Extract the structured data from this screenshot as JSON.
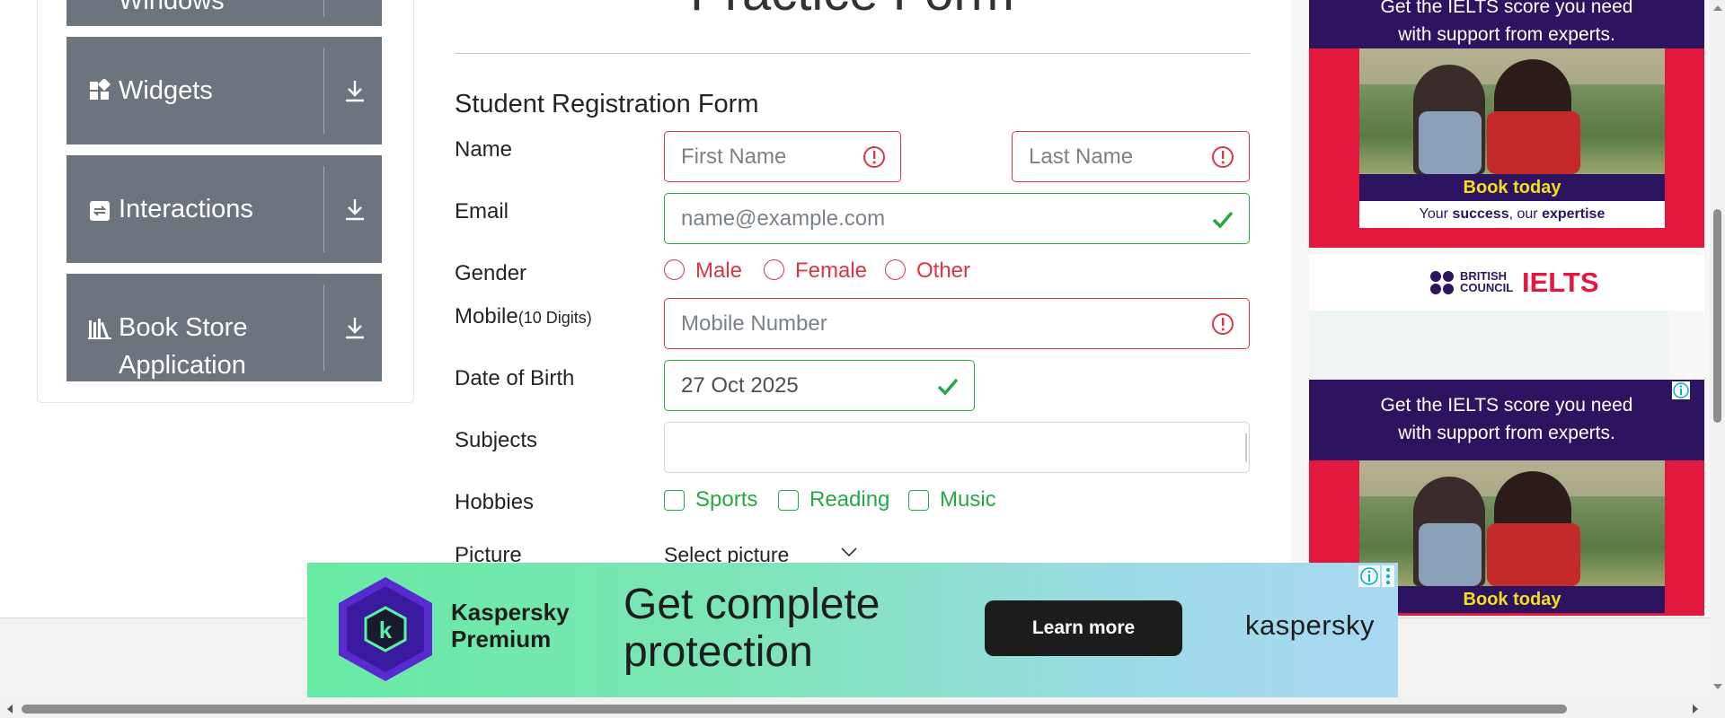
{
  "sidebar": {
    "items": [
      {
        "label": "Windows",
        "icon": "alert-icon"
      },
      {
        "label": "Widgets",
        "icon": "widgets-icon"
      },
      {
        "label": "Interactions",
        "icon": "interactions-icon"
      },
      {
        "label_line1": "Book Store",
        "label_line2": "Application",
        "icon": "book-store-icon"
      }
    ]
  },
  "form": {
    "page_title": "Practice Form",
    "heading": "Student Registration Form",
    "name_label": "Name",
    "first_name_placeholder": "First Name",
    "last_name_placeholder": "Last Name",
    "email_label": "Email",
    "email_placeholder": "name@example.com",
    "gender_label": "Gender",
    "gender_options": [
      "Male",
      "Female",
      "Other"
    ],
    "mobile_label": "Mobile",
    "mobile_hint": "(10 Digits)",
    "mobile_placeholder": "Mobile Number",
    "dob_label": "Date of Birth",
    "dob_value": "27 Oct 2025",
    "subjects_label": "Subjects",
    "subjects_value": "",
    "hobbies_label": "Hobbies",
    "hobbies_options": [
      "Sports",
      "Reading",
      "Music"
    ],
    "picture_label": "Picture",
    "picture_select": "Select picture"
  },
  "ads": {
    "ielts_headline_line1": "Get the IELTS score you need",
    "ielts_headline_line2": "with support from experts.",
    "ielts_cta": "Book today",
    "ielts_tagline_prefix": "Your ",
    "ielts_tagline_b1": "success",
    "ielts_tagline_mid": ", our ",
    "ielts_tagline_b2": "expertise",
    "ielts_brand1_line1": "BRITISH",
    "ielts_brand1_line2": "COUNCIL",
    "ielts_brand2": "IELTS",
    "kaspersky_product_line1": "Kaspersky",
    "kaspersky_product_line2": "Premium",
    "kaspersky_headline_line1": "Get complete",
    "kaspersky_headline_line2": "protection",
    "kaspersky_cta": "Learn more",
    "kaspersky_brand": "kaspersky"
  },
  "colors": {
    "sidebar_item": "#6c757d",
    "invalid": "#dc3545",
    "valid": "#28a745",
    "ielts_purple": "#2d1460",
    "ielts_red": "#e2183f"
  },
  "status": {
    "first_name": "invalid",
    "last_name": "invalid",
    "email": "valid",
    "mobile": "invalid",
    "dob": "valid"
  }
}
